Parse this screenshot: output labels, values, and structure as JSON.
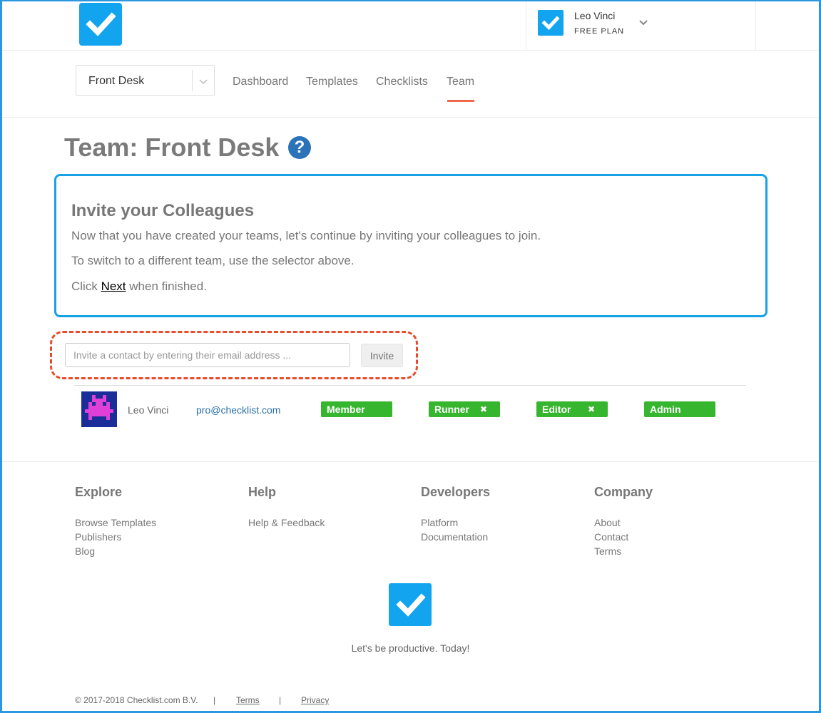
{
  "header": {
    "logo_icon": "checkmark-logo-icon",
    "user": {
      "name": "Leo Vinci",
      "plan": "FREE PLAN",
      "menu_icon": "chevron-down-icon"
    }
  },
  "nav": {
    "team_selector": {
      "value": "Front Desk",
      "icon": "chevron-down-icon"
    },
    "links": [
      "Dashboard",
      "Templates",
      "Checklists",
      "Team"
    ],
    "active": "Team",
    "accent_color": "#ee6a4d"
  },
  "page": {
    "title": "Team: Front Desk",
    "help_icon_text": "?"
  },
  "invite_box": {
    "title": "Invite your Colleagues",
    "line1": "Now that you have created your teams, let's continue by inviting your colleagues to join.",
    "line2": "To switch to a different team, use the selector above.",
    "line3_prefix": "Click ",
    "line3_link": "Next",
    "line3_suffix": " when finished.",
    "border_color": "#17a2e6"
  },
  "invite_form": {
    "placeholder": "Invite a contact by entering their email address ...",
    "button": "Invite"
  },
  "members": [
    {
      "name": "Leo Vinci",
      "email": "pro@checklist.com",
      "roles": [
        {
          "label": "Member",
          "removable": false
        },
        {
          "label": "Runner",
          "removable": true
        },
        {
          "label": "Editor",
          "removable": true
        },
        {
          "label": "Admin",
          "removable": false
        }
      ],
      "remove_glyph": "✖",
      "role_color": "#36b52e"
    }
  ],
  "footer": {
    "columns": [
      {
        "heading": "Explore",
        "links": [
          "Browse Templates",
          "Publishers",
          "Blog"
        ]
      },
      {
        "heading": "Help",
        "links": [
          "Help & Feedback"
        ]
      },
      {
        "heading": "Developers",
        "links": [
          "Platform",
          "Documentation"
        ]
      },
      {
        "heading": "Company",
        "links": [
          "About",
          "Contact",
          "Terms"
        ]
      }
    ],
    "tagline": "Let's be productive. Today!",
    "copyright": "© 2017-2018 Checklist.com B.V.",
    "separator": "|",
    "bottom_links": [
      "Terms",
      "Privacy"
    ]
  }
}
